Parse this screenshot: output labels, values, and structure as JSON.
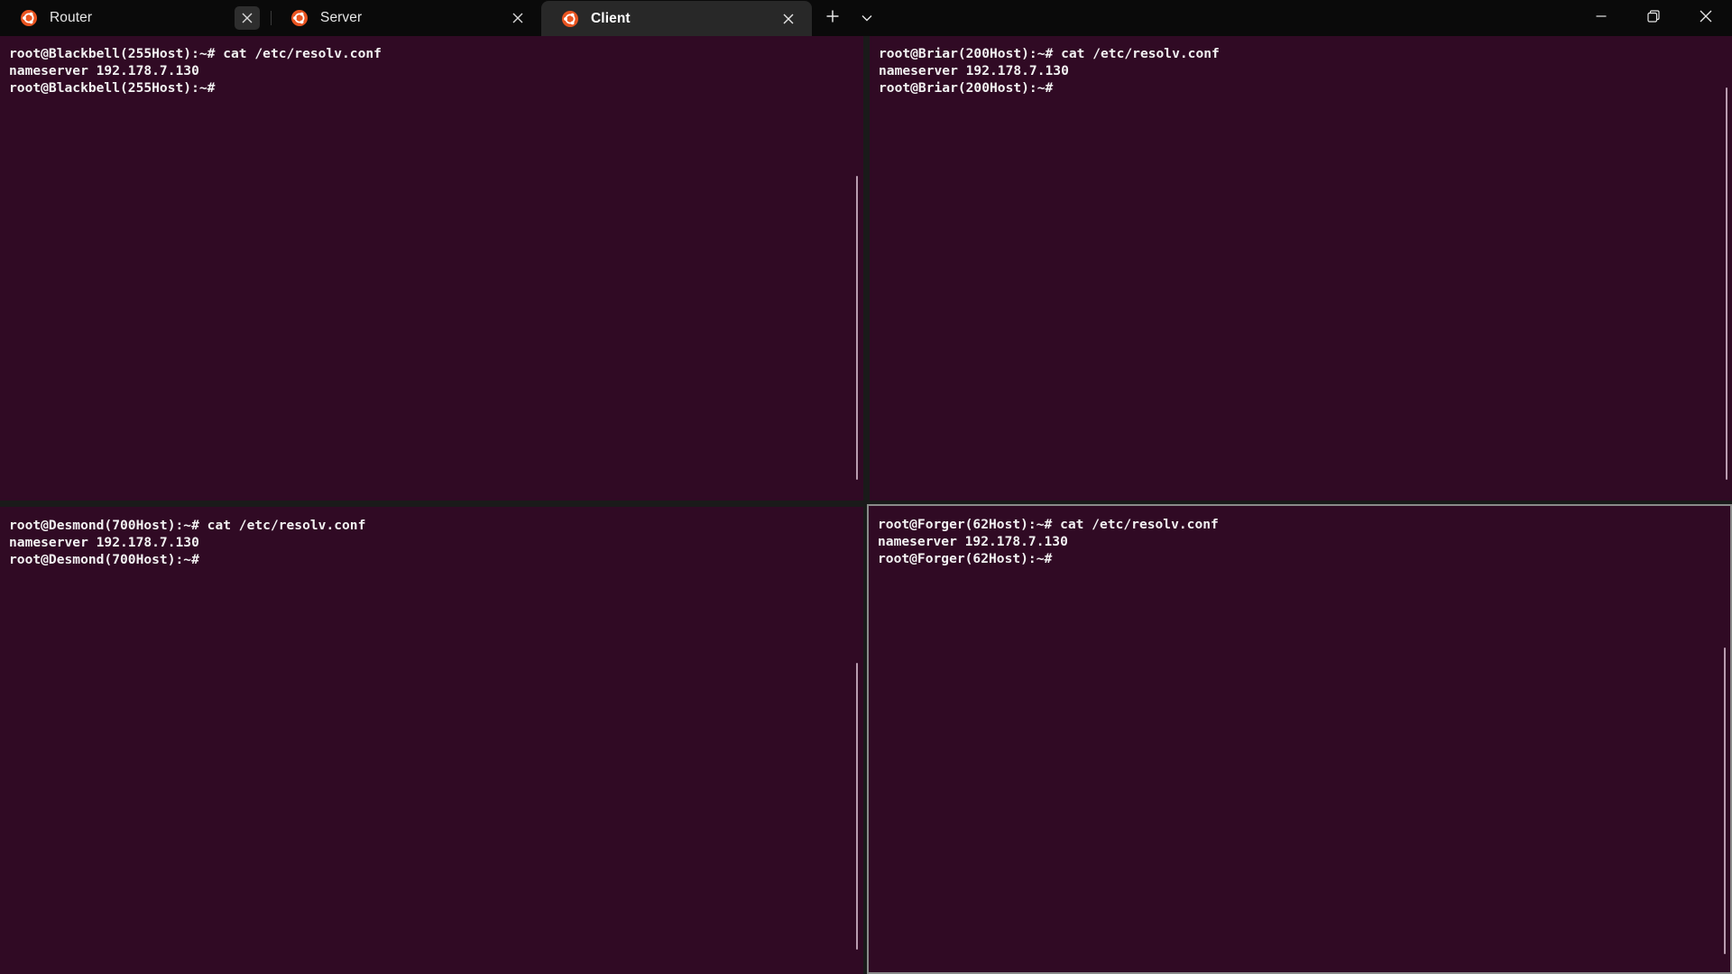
{
  "tabs": [
    {
      "label": "Router",
      "active": false,
      "icon": "ubuntu-icon"
    },
    {
      "label": "Server",
      "active": false,
      "icon": "ubuntu-icon"
    },
    {
      "label": "Client",
      "active": true,
      "icon": "ubuntu-icon"
    }
  ],
  "titlebar": {
    "new_tab_icon": "plus-icon",
    "dropdown_icon": "chevron-down-icon",
    "window_controls": [
      "minimize-icon",
      "restore-icon",
      "close-icon"
    ]
  },
  "colors": {
    "pane_background": "#300a24",
    "text": "#f2f2f2",
    "ubuntu_orange": "#e95420",
    "titlebar": "#0a0a0a",
    "active_tab": "#282828"
  },
  "panes": {
    "top_left": {
      "lines": [
        "root@Blackbell(255Host):~# cat /etc/resolv.conf",
        "nameserver 192.178.7.130",
        "root@Blackbell(255Host):~#"
      ]
    },
    "top_right": {
      "lines": [
        "root@Briar(200Host):~# cat /etc/resolv.conf",
        "nameserver 192.178.7.130",
        "root@Briar(200Host):~#"
      ]
    },
    "bottom_left": {
      "lines": [
        "root@Desmond(700Host):~# cat /etc/resolv.conf",
        "nameserver 192.178.7.130",
        "root@Desmond(700Host):~#"
      ]
    },
    "bottom_right": {
      "focused": true,
      "lines": [
        "root@Forger(62Host):~# cat /etc/resolv.conf",
        "nameserver 192.178.7.130",
        "root@Forger(62Host):~#"
      ]
    }
  }
}
